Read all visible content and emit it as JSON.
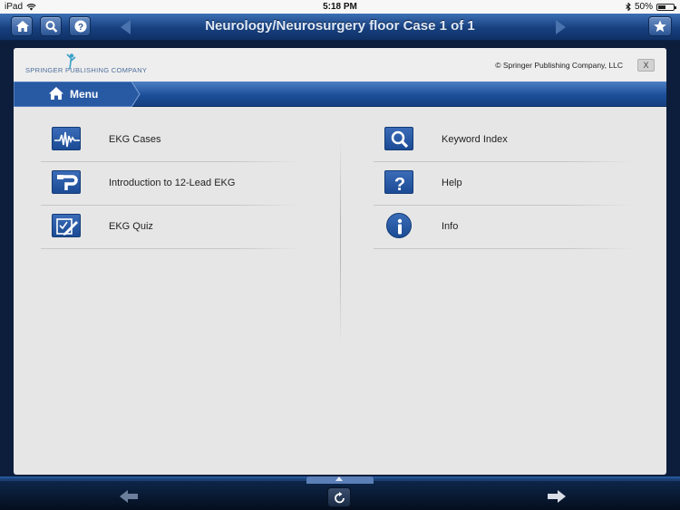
{
  "status_bar": {
    "device": "iPad",
    "time": "5:18 PM",
    "battery": "50%",
    "battery_level": 0.5
  },
  "navbar": {
    "title": "Neurology/Neurosurgery floor Case 1 of 1"
  },
  "panel": {
    "logo_text": "SPRINGER PUBLISHING COMPANY",
    "copyright": "© Springer Publishing Company, LLC",
    "close_label": "X",
    "menu_label": "Menu"
  },
  "menu_left": [
    {
      "label": "EKG Cases",
      "icon": "ekg-wave-icon"
    },
    {
      "label": "Introduction to 12-Lead EKG",
      "icon": "lead-connector-icon"
    },
    {
      "label": "EKG Quiz",
      "icon": "quiz-pencil-icon"
    }
  ],
  "menu_right": [
    {
      "label": "Keyword Index",
      "icon": "magnifier-icon"
    },
    {
      "label": "Help",
      "icon": "question-icon"
    },
    {
      "label": "Info",
      "icon": "info-icon"
    }
  ],
  "colors": {
    "accent": "#1c4f99",
    "panel_bg": "#e6e6e6",
    "navbar": "#17407e"
  }
}
